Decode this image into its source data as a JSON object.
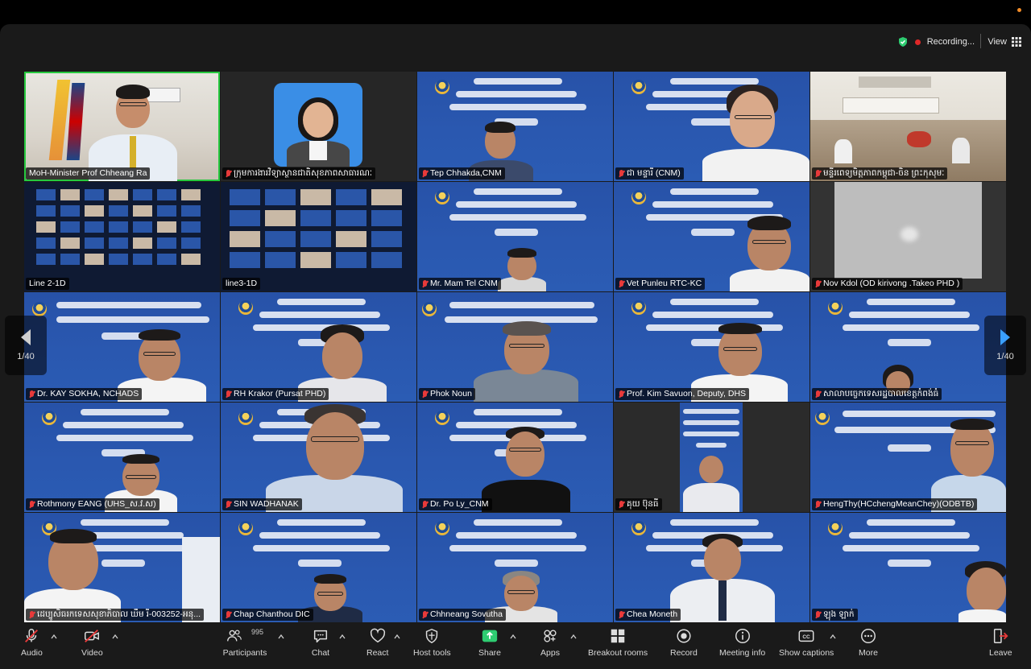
{
  "top": {
    "recording_label": "Recording...",
    "view_label": "View"
  },
  "pager": {
    "left_label": "1/40",
    "right_label": "1/40"
  },
  "tiles": [
    {
      "name": "MoH-Minister Prof Chheang Ra",
      "muted": false
    },
    {
      "name": "ក្រុមការងារវិទ្យាស្ថានជាតិសុខភាពសាធារណៈ",
      "muted": true
    },
    {
      "name": "Tep Chhakda,CNM",
      "muted": true
    },
    {
      "name": "ជា មន្ទារី (CNM)",
      "muted": true
    },
    {
      "name": "មន្ទីរពេទ្យមិត្តភាពកម្ពុជា-ចិន ព្រះកុសុមៈ",
      "muted": true
    },
    {
      "name": "Line 2-1D",
      "muted": false
    },
    {
      "name": "line3-1D",
      "muted": false
    },
    {
      "name": "Mr. Mam Tel CNM",
      "muted": true
    },
    {
      "name": "Vet Punleu RTC-KC",
      "muted": true
    },
    {
      "name": "Nov Kdol (OD kirivong .Takeo PHD )",
      "muted": true
    },
    {
      "name": "Dr. KAY SOKHA, NCHADS",
      "muted": true
    },
    {
      "name": "RH Krakor (Pursat PHD)",
      "muted": true
    },
    {
      "name": "Phok Noun",
      "muted": true
    },
    {
      "name": "Prof. Kim Savuon, Deputy, DHS",
      "muted": true
    },
    {
      "name": "សាលាបច្ចេកទេសរដ្ឋបាលខេត្តកំពង់ធំ",
      "muted": true
    },
    {
      "name": "Rothmony EANG (UHS_ស.វ.ស)",
      "muted": true
    },
    {
      "name": "SIN WADHANAK",
      "muted": true
    },
    {
      "name": "Dr. Po Ly_CNM",
      "muted": true
    },
    {
      "name": "គុយ ប៊ុនធី",
      "muted": true
    },
    {
      "name": "HengThy(HCchengMeanChey)(ODBTB)",
      "muted": true
    },
    {
      "name": "ដេប្បូសិធរកទេសសុខាភិបាល ឃឹម រី-003252-អនុ...",
      "muted": true
    },
    {
      "name": "Chap Chanthou DIC",
      "muted": true
    },
    {
      "name": "Chhneang Sovutha",
      "muted": true
    },
    {
      "name": "Chea Moneth",
      "muted": true
    },
    {
      "name": "ឡុង ឡាក់",
      "muted": true
    }
  ],
  "toolbar": {
    "audio": "Audio",
    "video": "Video",
    "participants": "Participants",
    "participants_count": "995",
    "chat": "Chat",
    "react": "React",
    "host_tools": "Host tools",
    "share": "Share",
    "apps": "Apps",
    "breakout_rooms": "Breakout rooms",
    "record": "Record",
    "meeting_info": "Meeting info",
    "show_captions": "Show captions",
    "more": "More",
    "leave": "Leave"
  },
  "colors": {
    "slide_blue": "#2a58b0",
    "active_speaker": "#27c93f",
    "recording_dot": "#e02828",
    "share_green": "#2ecc71",
    "leave_red": "#e83a3a"
  }
}
